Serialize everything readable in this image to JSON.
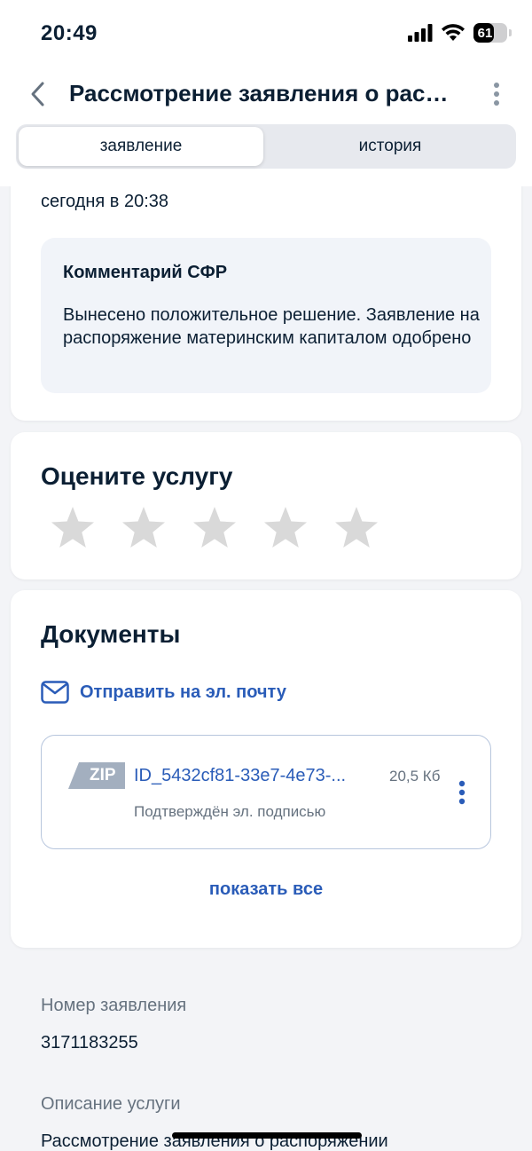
{
  "status_bar": {
    "time": "20:49",
    "battery": "61",
    "battery_fraction": 0.61
  },
  "header": {
    "title": "Рассмотрение заявления о распоряжении",
    "back_icon": "chevron-left-icon",
    "more_icon": "vertical-dots-icon"
  },
  "tabs": [
    {
      "label": "заявление",
      "active": true
    },
    {
      "label": "история",
      "active": false
    }
  ],
  "status_card": {
    "date": "сегодня в 20:38",
    "comment": {
      "title": "Комментарий СФР",
      "text": "Вынесено положительное решение. Заявление на распоряжение материнским капиталом одобрено"
    }
  },
  "rating": {
    "title": "Оцените услугу",
    "stars_total": 5,
    "stars_selected": 0
  },
  "documents": {
    "title": "Документы",
    "email_label": "Отправить на эл. почту",
    "file": {
      "type": "ZIP",
      "name": "ID_5432cf81-33e7-4e73-...",
      "size": "20,5 Кб",
      "signature": "Подтверждён эл. подписью"
    },
    "show_all": "показать все"
  },
  "application_info": {
    "number_label": "Номер заявления",
    "number_value": "3171183255",
    "description_label": "Описание услуги",
    "description_value": "Рассмотрение заявления о распоряжении"
  },
  "colors": {
    "accent": "#2a5cb8",
    "muted": "#66727f",
    "background": "#f3f4f7",
    "comment_bg": "#f1f4f9",
    "star": "#d9d9d9"
  }
}
